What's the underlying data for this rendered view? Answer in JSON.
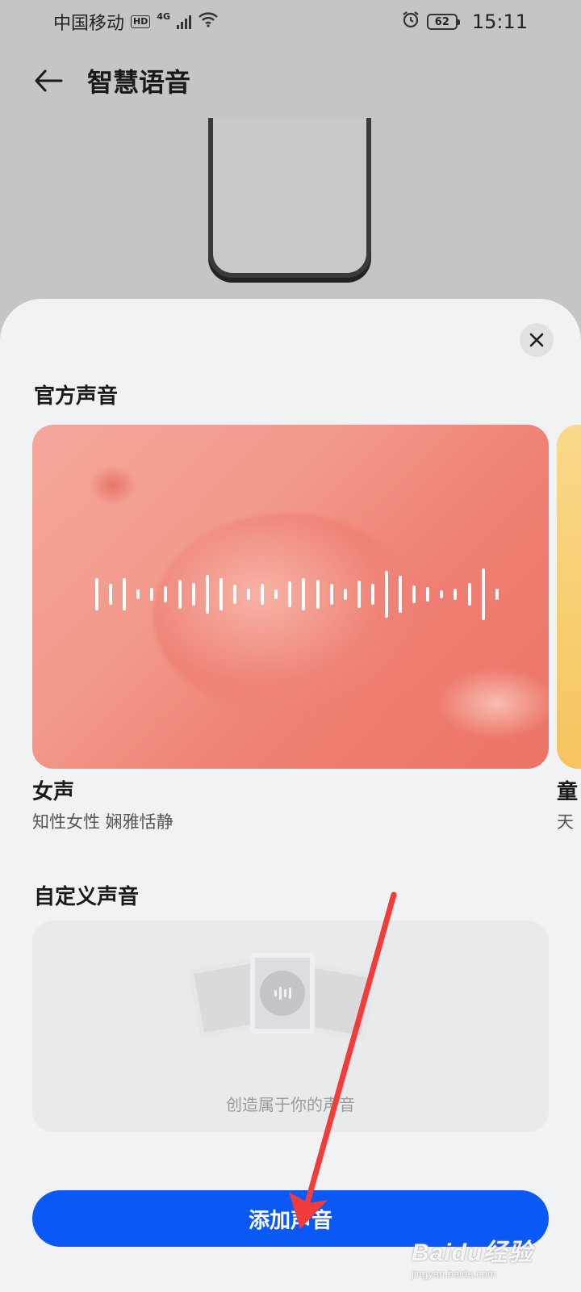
{
  "status_bar": {
    "carrier": "中国移动",
    "hd": "HD",
    "network": "4G",
    "battery": "62",
    "time": "15:11"
  },
  "header": {
    "title": "智慧语音"
  },
  "sheet": {
    "official_section_title": "官方声音",
    "voices": [
      {
        "name": "女声",
        "description": "知性女性 娴雅恬静"
      },
      {
        "name": "童",
        "description": "天"
      }
    ],
    "custom_section_title": "自定义声音",
    "custom_hint": "创造属于你的声音",
    "add_button_label": "添加声音"
  },
  "watermark": {
    "logo": "Baidu经验",
    "url": "jingyan.baidu.com"
  },
  "colors": {
    "accent": "#0a59f7",
    "annotation": "#f23b3b"
  }
}
